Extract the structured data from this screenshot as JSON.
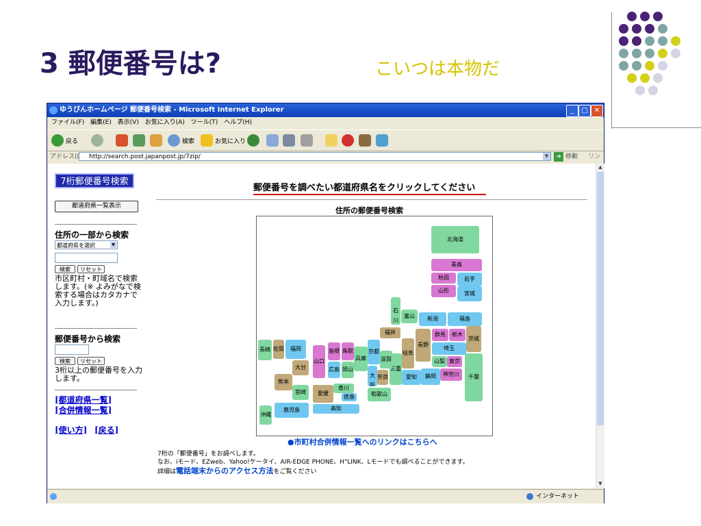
{
  "slide": {
    "title": "3 郵便番号は?",
    "subtitle": "こいつは本物だ",
    "colors": {
      "purple": "#4a2377",
      "teal": "#7fa6a4",
      "lime": "#d4d01a",
      "lavender": "#d4d4e6"
    }
  },
  "window": {
    "title": "ゆうびんホームページ 郵便番号検索 - Microsoft Internet Explorer",
    "minimize": "_",
    "maximize": "□",
    "close": "✕"
  },
  "menu": [
    "ファイル(F)",
    "編集(E)",
    "表示(V)",
    "お気に入り(A)",
    "ツール(T)",
    "ヘルプ(H)"
  ],
  "toolbar": {
    "back": "戻る",
    "search": "検索",
    "favorites": "お気に入り"
  },
  "address": {
    "label": "アドレス(D)",
    "url": "http://search.post.japanpost.jp/7zip/",
    "go": "移動",
    "links": "リンク"
  },
  "sidebar": {
    "logo": "7桁郵便番号検索",
    "pref_list_button": "都道府県一覧表示",
    "addr_heading": "住所の一部から検索",
    "pref_select": "都道府県を選択",
    "search_button": "検索",
    "reset_button": "リセット",
    "addr_help": "市区町村・町域名で検索します。(※ よみがなで検索する場合はカタカナで入力します。)",
    "zip_heading": "郵便番号から検索",
    "zip_help": "3桁以上の郵便番号を入力します。",
    "link_prefs": "[都道府県一覧]",
    "link_merge": "[合併情報一覧]",
    "link_howto": "[使い方]",
    "link_back": "[戻る]"
  },
  "main": {
    "instruction": "郵便番号を調べたい都道府県名をクリックしてください",
    "map_title": "住所の郵便番号検索",
    "merge_link": "●市町村合併情報一覧へのリンクはこちらへ",
    "info_line1": "7桁の「郵便番号」をお調べします。",
    "info_line2": "なお、iモード、EZweb、Yahoo!ケータイ、AIR-EDGE PHONE、H\"LINK、Lモードでも調べることができます。",
    "info_line3a": "詳細は",
    "info_line3b": "電話端末からのアクセス方法",
    "info_line3c": "をご覧ください"
  },
  "prefectures": [
    {
      "name": "北海道",
      "color": "#80d8a0"
    },
    {
      "name": "青森",
      "color": "#d878d0"
    },
    {
      "name": "秋田",
      "color": "#d878d0"
    },
    {
      "name": "岩手",
      "color": "#70c8f0"
    },
    {
      "name": "山形",
      "color": "#d878d0"
    },
    {
      "name": "宮城",
      "color": "#70c8f0"
    },
    {
      "name": "石川",
      "color": "#80d8a0"
    },
    {
      "name": "富山",
      "color": "#80d8a0"
    },
    {
      "name": "新潟",
      "color": "#70c8f0"
    },
    {
      "name": "福島",
      "color": "#70c8f0"
    },
    {
      "name": "福井",
      "color": "#c0a878"
    },
    {
      "name": "長野",
      "color": "#c0a878"
    },
    {
      "name": "群馬",
      "color": "#d878d0"
    },
    {
      "name": "栃木",
      "color": "#d878d0"
    },
    {
      "name": "茨城",
      "color": "#c0a878"
    },
    {
      "name": "岐阜",
      "color": "#c0a878"
    },
    {
      "name": "埼玉",
      "color": "#70c8f0"
    },
    {
      "name": "山梨",
      "color": "#80d8a0"
    },
    {
      "name": "東京",
      "color": "#d878d0"
    },
    {
      "name": "千葉",
      "color": "#80d8a0"
    },
    {
      "name": "神奈川",
      "color": "#d878d0"
    },
    {
      "name": "静岡",
      "color": "#70c8f0"
    },
    {
      "name": "愛知",
      "color": "#70c8f0"
    },
    {
      "name": "三重",
      "color": "#80d8a0"
    },
    {
      "name": "滋賀",
      "color": "#80d8a0"
    },
    {
      "name": "京都",
      "color": "#70c8f0"
    },
    {
      "name": "兵庫",
      "color": "#80d8a0"
    },
    {
      "name": "大阪",
      "color": "#70c8f0"
    },
    {
      "name": "奈良",
      "color": "#c0a878"
    },
    {
      "name": "和歌山",
      "color": "#80d8a0"
    },
    {
      "name": "鳥取",
      "color": "#d878d0"
    },
    {
      "name": "島根",
      "color": "#d878d0"
    },
    {
      "name": "岡山",
      "color": "#80d8a0"
    },
    {
      "name": "広島",
      "color": "#70c8f0"
    },
    {
      "name": "山口",
      "color": "#d878d0"
    },
    {
      "name": "香川",
      "color": "#80d8a0"
    },
    {
      "name": "徳島",
      "color": "#70c8f0"
    },
    {
      "name": "愛媛",
      "color": "#c0a878"
    },
    {
      "name": "高知",
      "color": "#70c8f0"
    },
    {
      "name": "福岡",
      "color": "#70c8f0"
    },
    {
      "name": "佐賀",
      "color": "#c0a878"
    },
    {
      "name": "長崎",
      "color": "#80d8a0"
    },
    {
      "name": "大分",
      "color": "#c0a878"
    },
    {
      "name": "熊本",
      "color": "#c0a878"
    },
    {
      "name": "宮崎",
      "color": "#80d8a0"
    },
    {
      "name": "鹿児島",
      "color": "#70c8f0"
    },
    {
      "name": "沖縄",
      "color": "#80d8a0"
    }
  ],
  "status": {
    "zone": "インターネット"
  }
}
